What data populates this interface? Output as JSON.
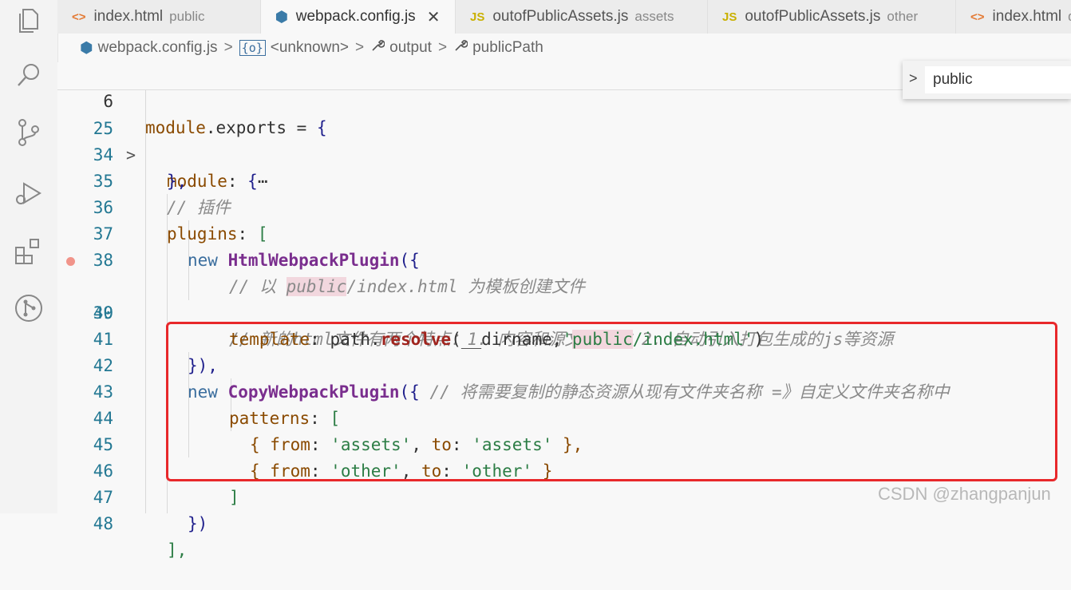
{
  "tabs": [
    {
      "icon": "<>",
      "name": "index.html",
      "hint": "public",
      "active": false
    },
    {
      "icon": "⬢",
      "name": "webpack.config.js",
      "hint": "",
      "active": true,
      "close": "✕"
    },
    {
      "icon": "JS",
      "name": "outofPublicAssets.js",
      "hint": "assets",
      "active": false
    },
    {
      "icon": "JS",
      "name": "outofPublicAssets.js",
      "hint": "other",
      "active": false
    },
    {
      "icon": "<>",
      "name": "index.html",
      "hint": "dis",
      "active": false
    }
  ],
  "breadcrumb": {
    "file": "webpack.config.js",
    "unknown": "<unknown>",
    "output": "output",
    "publicPath": "publicPath",
    "sep": ">"
  },
  "find": {
    "chevron": ">",
    "value": "public"
  },
  "lines": {
    "l6": {
      "n": "6",
      "a": "module",
      "b": ".exports = ",
      "c": "{"
    },
    "l25": {
      "n": "25",
      "fold": ">",
      "a": "module",
      "b": ": ",
      "c": "{",
      "d": "⋯"
    },
    "l34": {
      "n": "34",
      "a": "},"
    },
    "l35": {
      "n": "35",
      "a": "// 插件"
    },
    "l36": {
      "n": "36",
      "a": "plugins",
      "b": ": ",
      "c": "["
    },
    "l37": {
      "n": "37",
      "a": "new ",
      "b": "HtmlWebpackPlugin",
      "c": "({"
    },
    "l38": {
      "n": "38",
      "a": "// 以 ",
      "b": "public",
      "c": "/index.html 为模板创建文件"
    },
    "l39": {
      "n": "39",
      "a": "// 新的html文件有两个特点：1. 内容和源文件一致 2. 自动引入打包生成的js等资源"
    },
    "l40": {
      "n": "40",
      "a": "template",
      "b": ": path.",
      "c": "resolve",
      "d": "(__dirname,",
      "e": "'",
      "f": "public",
      "g": "/index.html'",
      "h": ")"
    },
    "l41": {
      "n": "41",
      "a": "}),"
    },
    "l42": {
      "n": "42",
      "a": "new ",
      "b": "CopyWebpackPlugin",
      "c": "({",
      "d": " // 将需要复制的静态资源从现有文件夹名称 =》自定义文件夹名称中"
    },
    "l43": {
      "n": "43",
      "a": "patterns",
      "b": ": ",
      "c": "["
    },
    "l44": {
      "n": "44",
      "a": "{ ",
      "b": "from",
      "c": ": ",
      "d": "'assets'",
      "e": ", ",
      "f": "to",
      "g": ": ",
      "h": "'assets'",
      "i": " },"
    },
    "l45": {
      "n": "45",
      "a": "{ ",
      "b": "from",
      "c": ": ",
      "d": "'other'",
      "e": ", ",
      "f": "to",
      "g": ": ",
      "h": "'other'",
      "i": " }"
    },
    "l46": {
      "n": "46",
      "a": "]"
    },
    "l47": {
      "n": "47",
      "a": "})"
    },
    "l48": {
      "n": "48",
      "a": "],"
    }
  },
  "watermark": "CSDN @zhangpanjun",
  "colors": {
    "highlight_box": "#e8282b",
    "breakpoint": "#f1948a"
  }
}
